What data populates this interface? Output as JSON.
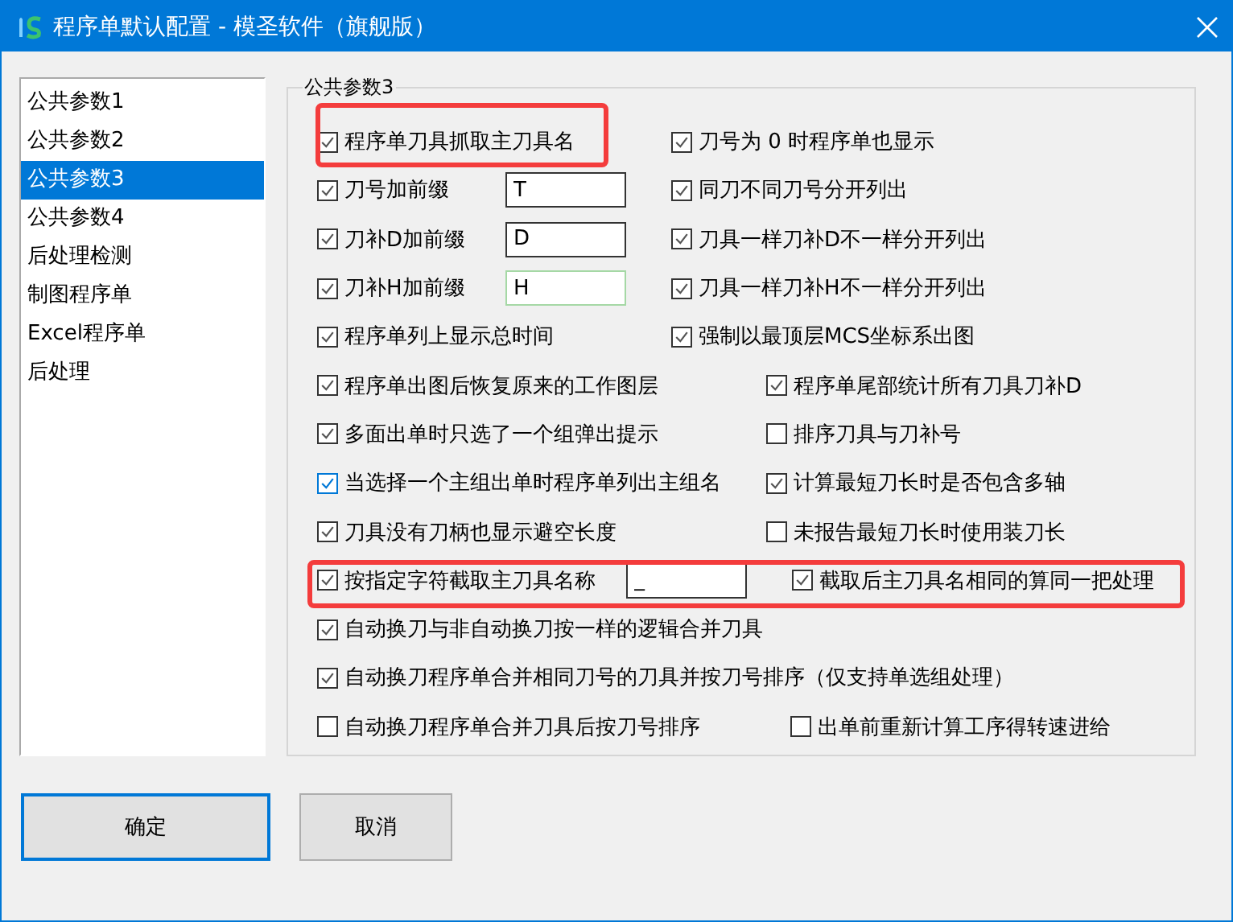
{
  "window": {
    "title": "程序单默认配置 - 模圣软件（旗舰版）"
  },
  "sidebar": {
    "items": [
      {
        "label": "公共参数1",
        "selected": false
      },
      {
        "label": "公共参数2",
        "selected": false
      },
      {
        "label": "公共参数3",
        "selected": true
      },
      {
        "label": "公共参数4",
        "selected": false
      },
      {
        "label": "后处理检测",
        "selected": false
      },
      {
        "label": "制图程序单",
        "selected": false
      },
      {
        "label": "Excel程序单",
        "selected": false
      },
      {
        "label": "后处理",
        "selected": false
      }
    ]
  },
  "group": {
    "title": "公共参数3",
    "rows": [
      {
        "items": [
          {
            "kind": "checkbox",
            "label": "程序单刀具抓取主刀具名",
            "checked": true,
            "highlighted": true
          },
          {
            "kind": "checkbox",
            "label": "刀号为 0 时程序单也显示",
            "checked": true
          }
        ]
      },
      {
        "items": [
          {
            "kind": "checkbox",
            "label": "刀号加前缀",
            "checked": true
          },
          {
            "kind": "field",
            "value": "T",
            "hovered": false
          },
          {
            "kind": "checkbox",
            "label": "同刀不同刀号分开列出",
            "checked": true
          }
        ]
      },
      {
        "items": [
          {
            "kind": "checkbox",
            "label": "刀补D加前缀",
            "checked": true
          },
          {
            "kind": "field",
            "value": "D",
            "hovered": false
          },
          {
            "kind": "checkbox",
            "label": "刀具一样刀补D不一样分开列出",
            "checked": true
          }
        ]
      },
      {
        "items": [
          {
            "kind": "checkbox",
            "label": "刀补H加前缀",
            "checked": true
          },
          {
            "kind": "field",
            "value": "H",
            "hovered": true
          },
          {
            "kind": "checkbox",
            "label": "刀具一样刀补H不一样分开列出",
            "checked": true
          }
        ]
      },
      {
        "items": [
          {
            "kind": "checkbox",
            "label": "程序单列上显示总时间",
            "checked": true
          },
          {
            "kind": "checkbox",
            "label": "强制以最顶层MCS坐标系出图",
            "checked": true
          }
        ]
      },
      {
        "items": [
          {
            "kind": "checkbox",
            "label": "程序单出图后恢复原来的工作图层",
            "checked": true
          },
          {
            "kind": "checkbox",
            "label": "程序单尾部统计所有刀具刀补D",
            "checked": true
          }
        ]
      },
      {
        "items": [
          {
            "kind": "checkbox",
            "label": "多面出单时只选了一个组弹出提示",
            "checked": true
          },
          {
            "kind": "checkbox",
            "label": "排序刀具与刀补号",
            "checked": false
          }
        ]
      },
      {
        "items": [
          {
            "kind": "checkbox",
            "label": "当选择一个主组出单时程序单列出主组名",
            "checked": true,
            "focused": true
          },
          {
            "kind": "checkbox",
            "label": "计算最短刀长时是否包含多轴",
            "checked": true
          }
        ]
      },
      {
        "items": [
          {
            "kind": "checkbox",
            "label": "刀具没有刀柄也显示避空长度",
            "checked": true
          },
          {
            "kind": "checkbox",
            "label": "未报告最短刀长时使用装刀长",
            "checked": false
          }
        ]
      },
      {
        "items": [
          {
            "kind": "checkbox",
            "label": "按指定字符截取主刀具名称",
            "checked": true,
            "highlighted": true
          },
          {
            "kind": "field",
            "value": "_",
            "hovered": false
          },
          {
            "kind": "checkbox",
            "label": "截取后主刀具名相同的算同一把处理",
            "checked": true,
            "highlighted": true
          }
        ]
      },
      {
        "items": [
          {
            "kind": "checkbox",
            "label": "自动换刀与非自动换刀按一样的逻辑合并刀具",
            "checked": true
          }
        ]
      },
      {
        "items": [
          {
            "kind": "checkbox",
            "label": "自动换刀程序单合并相同刀号的刀具并按刀号排序（仅支持单选组处理）",
            "checked": true
          }
        ]
      },
      {
        "items": [
          {
            "kind": "checkbox",
            "label": "自动换刀程序单合并刀具后按刀号排序",
            "checked": false
          },
          {
            "kind": "checkbox",
            "label": "出单前重新计算工序得转速进给",
            "checked": false
          }
        ]
      }
    ]
  },
  "buttons": [
    {
      "label": "确定",
      "default": true
    },
    {
      "label": "取消",
      "default": false
    }
  ]
}
